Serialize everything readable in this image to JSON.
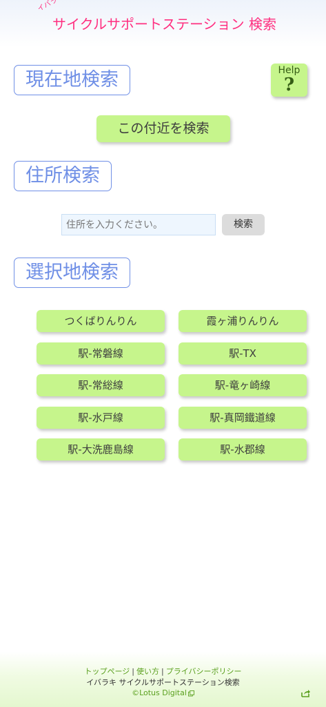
{
  "header": {
    "logo_small": "イバラキ",
    "logo_main": "サイクルサポートステーション 検索"
  },
  "current_location": {
    "title": "現在地検索",
    "nearby_button": "この付近を検索"
  },
  "help": {
    "label": "Help",
    "mark": "?"
  },
  "address": {
    "title": "住所検索",
    "placeholder": "住所を入力ください。",
    "search_button": "検索"
  },
  "selection": {
    "title": "選択地検索",
    "items": [
      "つくばりんりん",
      "霞ヶ浦りんりん",
      "駅-常磐線",
      "駅-TX",
      "駅-常総線",
      "駅-竜ヶ崎線",
      "駅-水戸線",
      "駅-真岡鐵道線",
      "駅-大洗鹿島線",
      "駅-水郡線"
    ]
  },
  "footer": {
    "links": [
      "トップページ",
      "使い方",
      "プライバシーポリシー"
    ],
    "separator": "|",
    "subtitle": "イバラキ サイクルサポートステーション検索",
    "copyright": "©Lotus Digital"
  },
  "colors": {
    "accent_pink": "#ff2f80",
    "title_blue": "#6f8fe6",
    "button_green": "#c6f58c",
    "link_green": "#5aa01e"
  }
}
